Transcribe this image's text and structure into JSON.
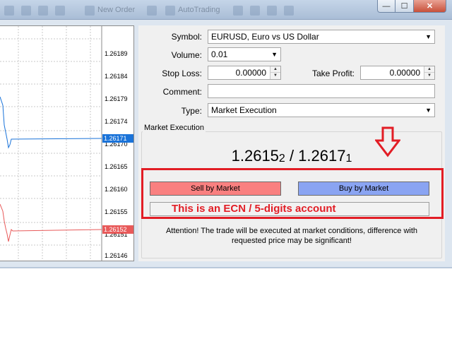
{
  "titlebar": {
    "new_order_label": "New Order",
    "auto_trading_label": "AutoTrading",
    "minimize_glyph": "—",
    "maximize_glyph": "☐",
    "close_glyph": "✕"
  },
  "chart": {
    "price_labels": [
      "1.26189",
      "1.26184",
      "1.26179",
      "1.26174",
      "1.26170",
      "1.26165",
      "1.26160",
      "1.26155",
      "1.26151",
      "1.26146"
    ],
    "ask_tag": "1.26171",
    "bid_tag": "1.26152",
    "ask_color": "#1a73d9",
    "bid_color": "#e85a5a"
  },
  "order": {
    "symbol_label": "Symbol:",
    "symbol_value": "EURUSD, Euro vs US Dollar",
    "volume_label": "Volume:",
    "volume_value": "0.01",
    "stoploss_label": "Stop Loss:",
    "stoploss_value": "0.00000",
    "takeprofit_label": "Take Profit:",
    "takeprofit_value": "0.00000",
    "comment_label": "Comment:",
    "comment_value": "",
    "type_label": "Type:",
    "type_value": "Market Execution",
    "group_title": "Market Execution",
    "bid_main": "1.2615",
    "bid_small": "2",
    "separator": " / ",
    "ask_main": "1.2617",
    "ask_small": "1",
    "sell_label": "Sell by Market",
    "buy_label": "Buy by Market",
    "ecn_label": "This is an ECN / 5-digits account",
    "attention_line1": "Attention! The trade will be executed at market conditions, difference with",
    "attention_line2": "requested price may be significant!"
  },
  "icons": {
    "dropdown": "chevron-down-icon",
    "spinner_up": "▲",
    "spinner_down": "▼",
    "annotation_arrow": "arrow-down-icon"
  },
  "colors": {
    "sell": "#f98080",
    "buy": "#8aa4f2",
    "annotation": "#e21d25"
  }
}
